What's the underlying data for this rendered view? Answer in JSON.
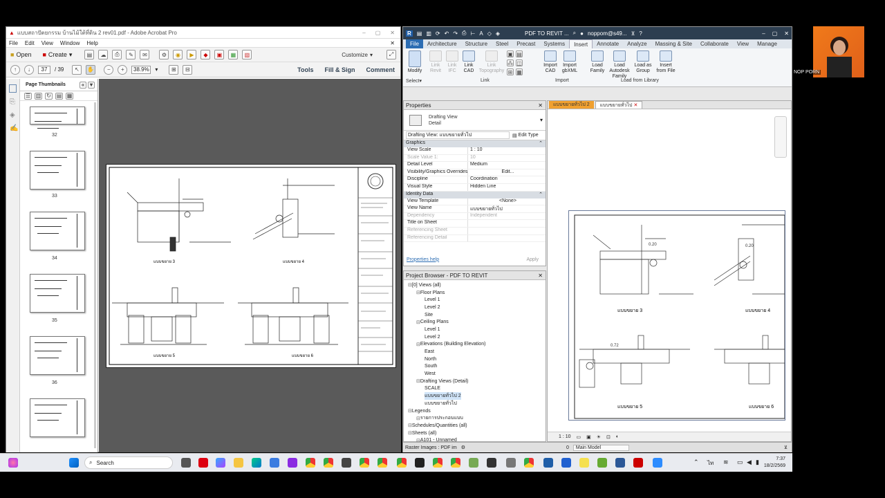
{
  "acrobat": {
    "title": "แบบสถาปัตยกรรม บ้านไม้ใต้ที่ดิน 2 rev01.pdf - Adobe Acrobat Pro",
    "menu": [
      "File",
      "Edit",
      "View",
      "Window",
      "Help"
    ],
    "open_label": "Open",
    "create_label": "Create",
    "customize_label": "Customize",
    "page_current": "37",
    "page_total": "/ 39",
    "zoom": "38.9%",
    "tools_label": "Tools",
    "fillsign_label": "Fill & Sign",
    "comment_label": "Comment",
    "thumbs_title": "Page Thumbnails",
    "thumb_numbers": [
      "32",
      "33",
      "34",
      "35",
      "36"
    ],
    "doc": {
      "caption_1": "แบบขยาย 3",
      "caption_2": "แบบขยาย 4",
      "caption_3": "แบบขยาย 5",
      "caption_4": "แบบขยาย 6"
    }
  },
  "revit": {
    "project": "PDF TO REVIT ...",
    "user": "noppom@s49...",
    "tabs": [
      "File",
      "Architecture",
      "Structure",
      "Steel",
      "Precast",
      "Systems",
      "Insert",
      "Annotate",
      "Analyze",
      "Massing & Site",
      "Collaborate",
      "View",
      "Manage"
    ],
    "active_tab": "Insert",
    "ribbon": {
      "modify": "Modify",
      "select": "Select",
      "link_revit": "Link Revit",
      "link_ifc": "Link IFC",
      "link_cad": "Link CAD",
      "link_topo": "Link Topography",
      "import_cad": "Import CAD",
      "import_gbxml": "Import gbXML",
      "load_family": "Load Family",
      "load_autodesk": "Load Autodesk Family",
      "load_group": "Load as Group",
      "insert_file": "Insert from File",
      "grp_link": "Link",
      "grp_import": "Import",
      "grp_library": "Load from Library"
    },
    "properties": {
      "title": "Properties",
      "type_name": "Drafting View",
      "type_sub": "Detail",
      "selector": "Drafting View: แบบขยายทั่วไป",
      "edit_type": "Edit Type",
      "sec_graphics": "Graphics",
      "sec_identity": "Identity Data",
      "rows_graphics": [
        {
          "k": "View Scale",
          "v": "1 : 10"
        },
        {
          "k": "Scale Value    1:",
          "v": "10"
        },
        {
          "k": "Detail Level",
          "v": "Medium"
        },
        {
          "k": "Visibility/Graphics Overrides",
          "v": "Edit..."
        },
        {
          "k": "Discipline",
          "v": "Coordination"
        },
        {
          "k": "Visual Style",
          "v": "Hidden Line"
        }
      ],
      "rows_identity": [
        {
          "k": "View Template",
          "v": "<None>"
        },
        {
          "k": "View Name",
          "v": "แบบขยายทั่วไป"
        },
        {
          "k": "Dependency",
          "v": "Independent"
        },
        {
          "k": "Title on Sheet",
          "v": ""
        },
        {
          "k": "Referencing Sheet",
          "v": ""
        },
        {
          "k": "Referencing Detail",
          "v": ""
        }
      ],
      "help": "Properties help",
      "apply": "Apply"
    },
    "browser": {
      "title": "Project Browser - PDF TO REVIT",
      "items": [
        {
          "t": "[0] Views (all)",
          "lvl": 0
        },
        {
          "t": "Floor Plans",
          "lvl": 1
        },
        {
          "t": "Level 1",
          "lvl": 2
        },
        {
          "t": "Level 2",
          "lvl": 2
        },
        {
          "t": "Site",
          "lvl": 2
        },
        {
          "t": "Ceiling Plans",
          "lvl": 1
        },
        {
          "t": "Level 1",
          "lvl": 2
        },
        {
          "t": "Level 2",
          "lvl": 2
        },
        {
          "t": "Elevations (Building Elevation)",
          "lvl": 1
        },
        {
          "t": "East",
          "lvl": 2
        },
        {
          "t": "North",
          "lvl": 2
        },
        {
          "t": "South",
          "lvl": 2
        },
        {
          "t": "West",
          "lvl": 2
        },
        {
          "t": "Drafting Views (Detail)",
          "lvl": 1
        },
        {
          "t": "SCALE",
          "lvl": 2
        },
        {
          "t": "แบบขยายทั่วไป 2",
          "lvl": 2
        },
        {
          "t": "แบบขยายทั่วไป",
          "lvl": 2
        },
        {
          "t": "Legends",
          "lvl": 0
        },
        {
          "t": "รายการประกอบแบบ",
          "lvl": 1
        },
        {
          "t": "Schedules/Quantities (all)",
          "lvl": 0
        },
        {
          "t": "Sheets (all)",
          "lvl": 0
        },
        {
          "t": "A101 - Unnamed",
          "lvl": 1
        }
      ]
    },
    "view_tabs": [
      "แบบขยายทั่วไป 2",
      "แบบขยายทั่วไป"
    ],
    "view": {
      "c1": "แบบขยาย 3",
      "c2": "แบบขยาย 4",
      "c3": "แบบขยาย 5",
      "c4": "แบบขยาย 6",
      "dim1": "0.20",
      "dim2": "0.20",
      "dim3": "0.72"
    },
    "view_scale": "1 : 10",
    "status_text": "Raster Images : PDF im",
    "model": "Main Model",
    "zero": "0"
  },
  "webcam": {
    "name": "NOP PORN"
  },
  "taskbar": {
    "search": "Search",
    "time": "7:37",
    "date": "18/2/2569"
  }
}
